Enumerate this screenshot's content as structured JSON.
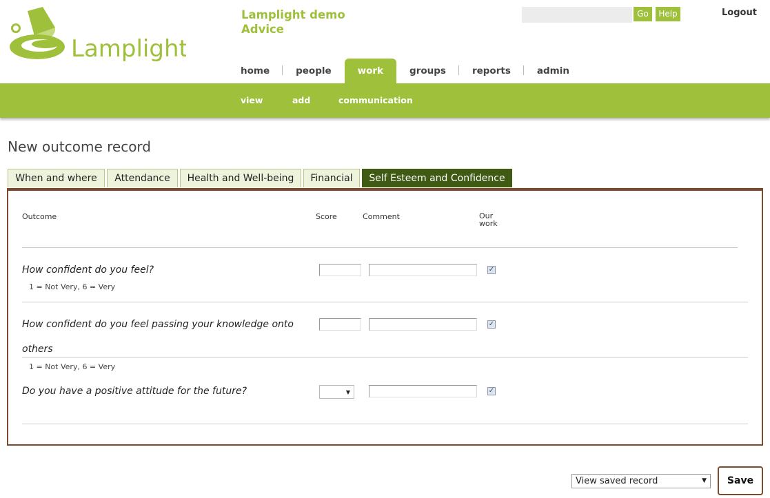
{
  "app": {
    "logo_text": "Lamplight",
    "org_line1": "Lamplight demo",
    "org_line2": "Advice",
    "search": {
      "value": "",
      "go_label": "Go"
    },
    "help_label": "Help",
    "logout_label": "Logout"
  },
  "nav": {
    "items": [
      {
        "label": "home"
      },
      {
        "label": "people"
      },
      {
        "label": "work"
      },
      {
        "label": "groups"
      },
      {
        "label": "reports"
      },
      {
        "label": "admin"
      }
    ],
    "active": "work",
    "sub": [
      {
        "label": "view"
      },
      {
        "label": "add"
      },
      {
        "label": "communication"
      }
    ]
  },
  "page": {
    "title": "New outcome record",
    "tabs": [
      {
        "label": "When and where"
      },
      {
        "label": "Attendance"
      },
      {
        "label": "Health and Well-being"
      },
      {
        "label": "Financial"
      },
      {
        "label": "Self Esteem and Confidence"
      }
    ],
    "active_tab": "Self Esteem and Confidence"
  },
  "table": {
    "headers": {
      "outcome": "Outcome",
      "score": "Score",
      "comment": "Comment",
      "our_work_1": "Our",
      "our_work_2": "work"
    },
    "rows": [
      {
        "question": "How confident do you feel?",
        "hint": "1 = Not Very, 6 = Very",
        "score": "",
        "comment": "",
        "our_work": true
      },
      {
        "question_line1": "How confident do you feel passing your knowledge onto",
        "question_line2": "others",
        "hint": "1 = Not Very, 6 = Very",
        "score": "",
        "comment": "",
        "our_work": true
      },
      {
        "question": "Do you have a positive attitude for the future?",
        "score": "",
        "comment": "",
        "our_work": true
      }
    ]
  },
  "footer": {
    "view_select": "View saved record",
    "save_label": "Save"
  },
  "colors": {
    "accent": "#9fc03a",
    "tab_active": "#3f5a12",
    "panel_border": "#7a4a2a"
  }
}
